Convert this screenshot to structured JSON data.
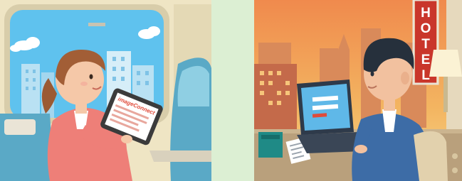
{
  "scenes": {
    "left": {
      "tablet_logo": "imageConnect"
    },
    "right": {
      "hotel_sign": [
        "H",
        "O",
        "T",
        "E",
        "L"
      ]
    }
  },
  "colors": {
    "background": "#dcefd3",
    "sky": "#5fc2ee",
    "sunset": "#f3b561",
    "jacket_pink": "#ee7f78",
    "suit_blue": "#3d6ca6",
    "hotel_sign_red": "#c9362b",
    "logo_red": "#e04b3a"
  }
}
